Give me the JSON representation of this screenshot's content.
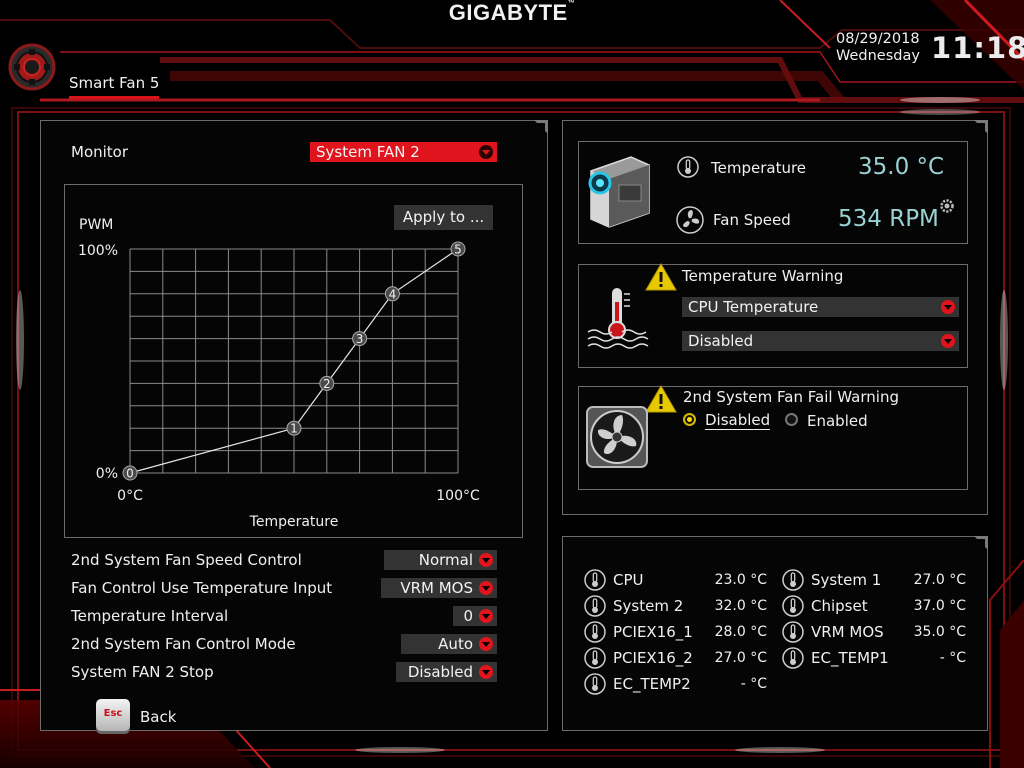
{
  "brand": "GIGABYTE",
  "brand_mark": "™",
  "header": {
    "title": "Smart Fan 5",
    "date": "08/29/2018",
    "day": "Wednesday",
    "time": "11:18"
  },
  "colors": {
    "accent": "#e0141c",
    "value_teal": "#9ad2d4",
    "warning_yellow": "#e8c800"
  },
  "left_panel": {
    "monitor_label": "Monitor",
    "monitor_value": "System FAN 2",
    "apply_button": "Apply to ...",
    "settings": [
      {
        "label": "2nd System Fan Speed Control",
        "value": "Normal"
      },
      {
        "label": "Fan Control Use Temperature Input",
        "value": "VRM MOS"
      },
      {
        "label": "Temperature Interval",
        "value": "0"
      },
      {
        "label": "2nd System Fan Control Mode",
        "value": "Auto"
      },
      {
        "label": "System FAN 2 Stop",
        "value": "Disabled"
      }
    ]
  },
  "chart_data": {
    "type": "line",
    "ylabel": "PWM",
    "xlabel": "Temperature",
    "y_ticks": [
      "100%",
      "0%"
    ],
    "x_ticks": [
      "0°C",
      "100°C"
    ],
    "xlim": [
      0,
      100
    ],
    "ylim": [
      0,
      100
    ],
    "grid": true,
    "points": [
      {
        "label": "0",
        "x": 0,
        "y": 0
      },
      {
        "label": "1",
        "x": 50,
        "y": 20
      },
      {
        "label": "2",
        "x": 60,
        "y": 40
      },
      {
        "label": "3",
        "x": 70,
        "y": 60
      },
      {
        "label": "4",
        "x": 80,
        "y": 80
      },
      {
        "label": "5",
        "x": 100,
        "y": 100
      }
    ]
  },
  "status_panel": {
    "temperature_label": "Temperature",
    "temperature_value": "35.0 °C",
    "fan_speed_label": "Fan Speed",
    "fan_speed_value": "534 RPM"
  },
  "temp_warning": {
    "title": "Temperature Warning",
    "source": "CPU Temperature",
    "value": "Disabled"
  },
  "fan_fail": {
    "title": "2nd System Fan Fail Warning",
    "options": [
      "Disabled",
      "Enabled"
    ],
    "selected": "Disabled"
  },
  "sensors": [
    {
      "name": "CPU",
      "value": "23.0 °C"
    },
    {
      "name": "System 1",
      "value": "27.0 °C"
    },
    {
      "name": "System 2",
      "value": "32.0 °C"
    },
    {
      "name": "Chipset",
      "value": "37.0 °C"
    },
    {
      "name": "PCIEX16_1",
      "value": "28.0 °C"
    },
    {
      "name": "VRM MOS",
      "value": "35.0 °C"
    },
    {
      "name": "PCIEX16_2",
      "value": "27.0 °C"
    },
    {
      "name": "EC_TEMP1",
      "value": "- °C"
    },
    {
      "name": "EC_TEMP2",
      "value": "- °C"
    }
  ],
  "footer": {
    "esc_key": "Esc",
    "back_label": "Back"
  }
}
